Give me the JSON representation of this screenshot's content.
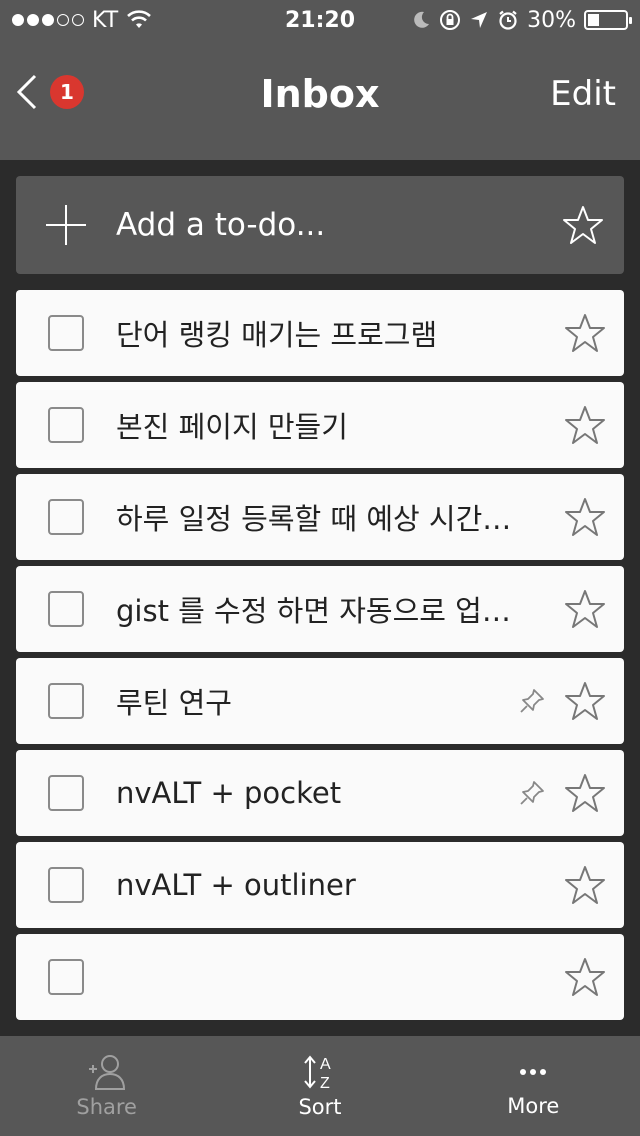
{
  "status": {
    "carrier": "KT",
    "time": "21:20",
    "battery": "30%",
    "battery_level": 0.3,
    "signal_bars_filled": 3,
    "signal_bars_total": 5
  },
  "nav": {
    "badge_count": "1",
    "title": "Inbox",
    "edit_label": "Edit"
  },
  "add_todo": {
    "placeholder": "Add a to-do..."
  },
  "tasks": [
    {
      "title": "단어 랭킹 매기는 프로그램",
      "pinned": false
    },
    {
      "title": "본진 페이지 만들기",
      "pinned": false
    },
    {
      "title": "하루 일정 등록할 때 예상 시간…",
      "pinned": false
    },
    {
      "title": "gist 를 수정 하면 자동으로 업…",
      "pinned": false
    },
    {
      "title": "루틴 연구",
      "pinned": true
    },
    {
      "title": "nvALT + pocket",
      "pinned": true
    },
    {
      "title": "nvALT + outliner",
      "pinned": false
    },
    {
      "title": "",
      "pinned": false
    }
  ],
  "toolbar": {
    "share_label": "Share",
    "sort_label": "Sort",
    "more_label": "More"
  },
  "colors": {
    "bar_background": "#575757",
    "badge": "#d9372f",
    "row_background": "#fafafa"
  }
}
